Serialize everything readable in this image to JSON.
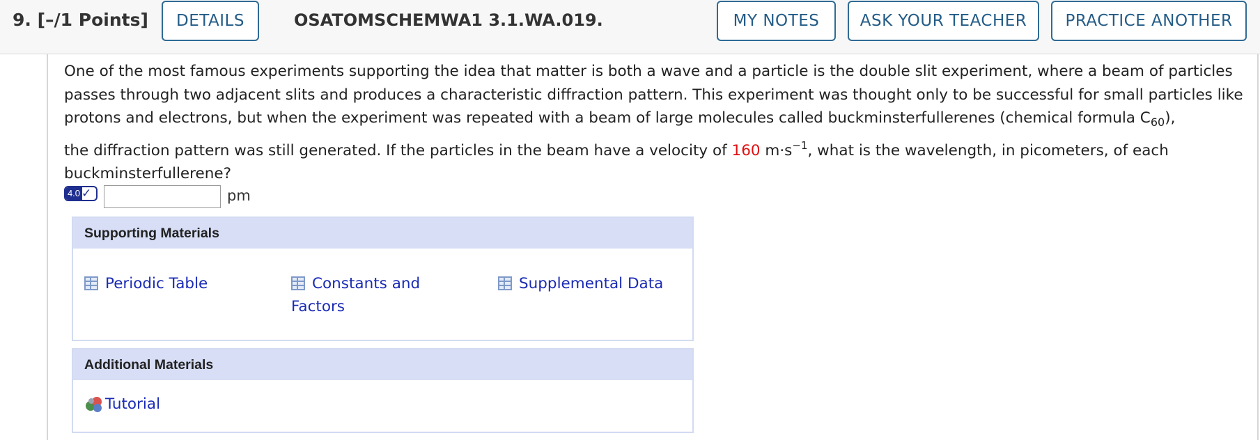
{
  "header": {
    "question_number": "9.",
    "points": "[–/1 Points]",
    "details_label": "DETAILS",
    "question_code": "OSATOMSCHEMWA1 3.1.WA.019.",
    "my_notes_label": "MY NOTES",
    "ask_teacher_label": "ASK YOUR TEACHER",
    "practice_label": "PRACTICE ANOTHER"
  },
  "question": {
    "paragraph1_part1": "One of the most famous experiments supporting the idea that matter is both a wave and a particle is the double slit experiment, where a beam of particles passes through two adjacent slits and produces a characteristic diffraction pattern. This experiment was thought only to be successful for small particles like protons and electrons, but when the experiment was repeated with a beam of large molecules called buckminsterfullerenes (chemical formula C",
    "formula_subscript": "60",
    "paragraph1_part2": "),",
    "paragraph2_part1": "the diffraction pattern was still generated. If the particles in the beam have a velocity of ",
    "velocity": "160",
    "unit_base": " m·s",
    "unit_exponent": "−1",
    "paragraph2_part2": ", what is the wavelength, in picometers, of each buckminsterfullerene?"
  },
  "answer": {
    "badge_value": "4.0",
    "badge_check": "✓",
    "input_value": "",
    "unit": "pm"
  },
  "supporting_materials": {
    "title": "Supporting Materials",
    "items": [
      {
        "label": "Periodic Table",
        "icon": "table-icon"
      },
      {
        "label": "Constants and Factors",
        "icon": "table-icon"
      },
      {
        "label": "Supplemental Data",
        "icon": "table-icon"
      }
    ]
  },
  "additional_materials": {
    "title": "Additional Materials",
    "items": [
      {
        "label": "Tutorial",
        "icon": "molecule-icon"
      }
    ]
  },
  "colors": {
    "button_border": "#2f6b95",
    "link": "#1a2bb5",
    "highlight_red": "#e01010",
    "panel_header": "#d7def6"
  }
}
